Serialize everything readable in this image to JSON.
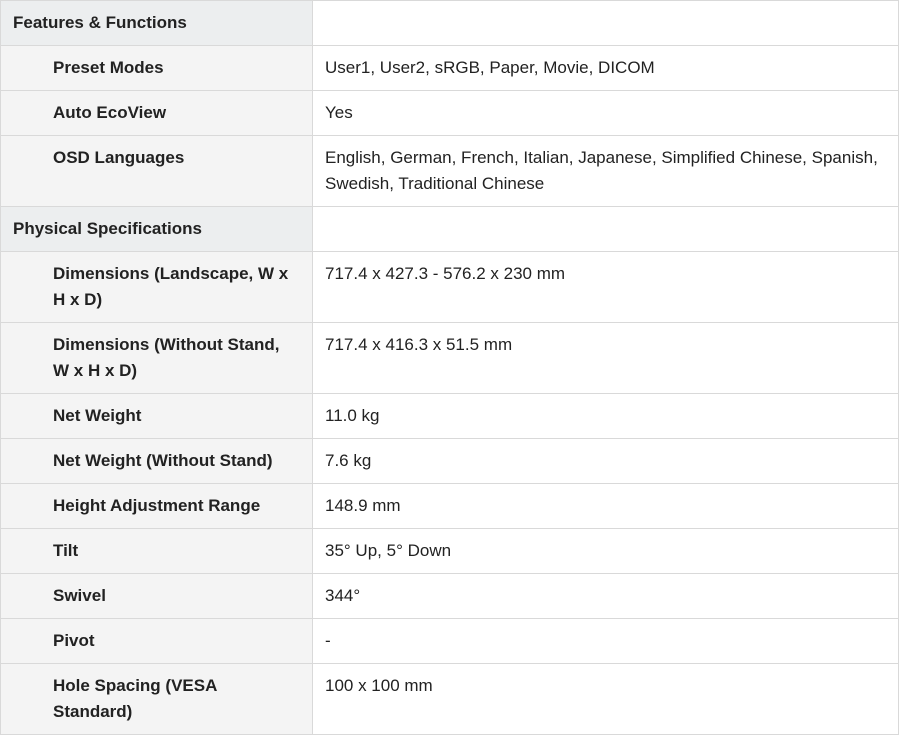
{
  "sections": [
    {
      "title": "Features & Functions",
      "rows": [
        {
          "label": "Preset Modes",
          "value": "User1, User2, sRGB, Paper, Movie, DICOM"
        },
        {
          "label": "Auto EcoView",
          "value": "Yes"
        },
        {
          "label": "OSD Languages",
          "value": "English, German, French, Italian, Japanese, Simplified Chinese, Spanish, Swedish, Traditional Chinese"
        }
      ]
    },
    {
      "title": "Physical Specifications",
      "rows": [
        {
          "label": "Dimensions (Landscape, W x H x D)",
          "value": "717.4 x 427.3 - 576.2 x 230 mm"
        },
        {
          "label": "Dimensions (Without Stand, W x H x D)",
          "value": "717.4 x 416.3 x 51.5 mm"
        },
        {
          "label": "Net Weight",
          "value": "11.0 kg"
        },
        {
          "label": "Net Weight (Without Stand)",
          "value": "7.6 kg"
        },
        {
          "label": "Height Adjustment Range",
          "value": "148.9 mm"
        },
        {
          "label": "Tilt",
          "value": "35° Up, 5° Down"
        },
        {
          "label": "Swivel",
          "value": "344°"
        },
        {
          "label": "Pivot",
          "value": "-"
        },
        {
          "label": "Hole Spacing (VESA Standard)",
          "value": "100 x 100 mm"
        }
      ]
    }
  ]
}
